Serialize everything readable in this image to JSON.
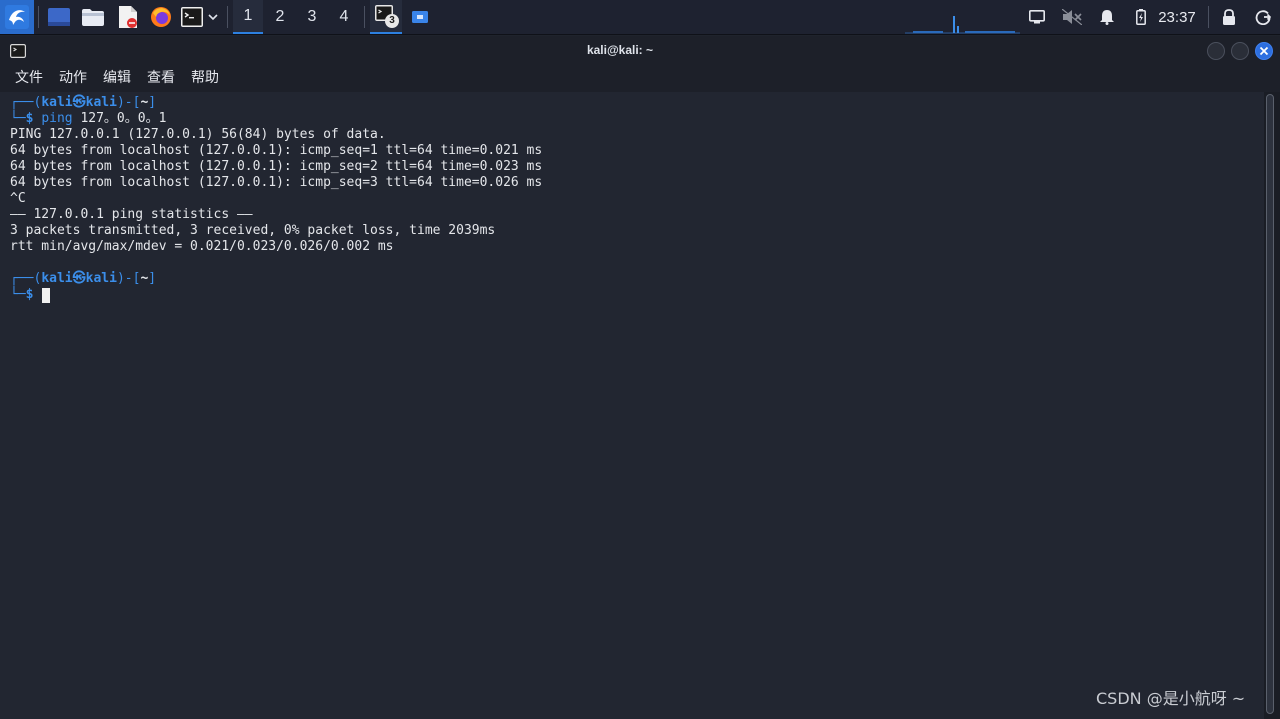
{
  "panel": {
    "workspaces": [
      "1",
      "2",
      "3",
      "4"
    ],
    "active_workspace": "1",
    "task_badge": "3",
    "clock": "23:37"
  },
  "window": {
    "title": "kali@kali: ~"
  },
  "menu": [
    "文件",
    "动作",
    "编辑",
    "查看",
    "帮助"
  ],
  "terminal": {
    "prompt1": {
      "open": "┌──(",
      "user": "kali",
      "at": "㉿",
      "host": "kali",
      "mid": ")-[",
      "dir": "~",
      "close": "]"
    },
    "prompt1_cmd": {
      "corner": "└─",
      "sign": "$",
      "cmd": "ping",
      "args": " 127。0。0。1"
    },
    "output": [
      "PING 127.0.0.1 (127.0.0.1) 56(84) bytes of data.",
      "64 bytes from localhost (127.0.0.1): icmp_seq=1 ttl=64 time=0.021 ms",
      "64 bytes from localhost (127.0.0.1): icmp_seq=2 ttl=64 time=0.023 ms",
      "64 bytes from localhost (127.0.0.1): icmp_seq=3 ttl=64 time=0.026 ms",
      "^C",
      "—— 127.0.0.1 ping statistics ——",
      "3 packets transmitted, 3 received, 0% packet loss, time 2039ms",
      "rtt min/avg/max/mdev = 0.021/0.023/0.026/0.002 ms"
    ],
    "prompt2": {
      "open": "┌──(",
      "user": "kali",
      "at": "㉿",
      "host": "kali",
      "mid": ")-[",
      "dir": "~",
      "close": "]"
    },
    "prompt2_cmd": {
      "corner": "└─",
      "sign": "$"
    }
  },
  "watermark": "CSDN @是小航呀 ~",
  "icons": {
    "kali_menu": "kali-dragon-icon",
    "show_desktop": "desktop-icon",
    "files": "folder-icon",
    "editor": "text-editor-icon",
    "browser": "firefox-icon",
    "terminal": "terminal-icon",
    "terminal_dropdown": "chevron-down-icon",
    "task_terminal": "terminal-task-icon",
    "task_other": "window-task-icon",
    "network": "network-icon",
    "volume": "volume-muted-icon",
    "notifications": "bell-icon",
    "battery": "battery-icon",
    "lock": "lock-icon",
    "logout": "power-icon"
  },
  "colors": {
    "accent": "#2d80e0",
    "prompt_blue": "#3b8eea",
    "close_button": "#2d6fe0"
  }
}
